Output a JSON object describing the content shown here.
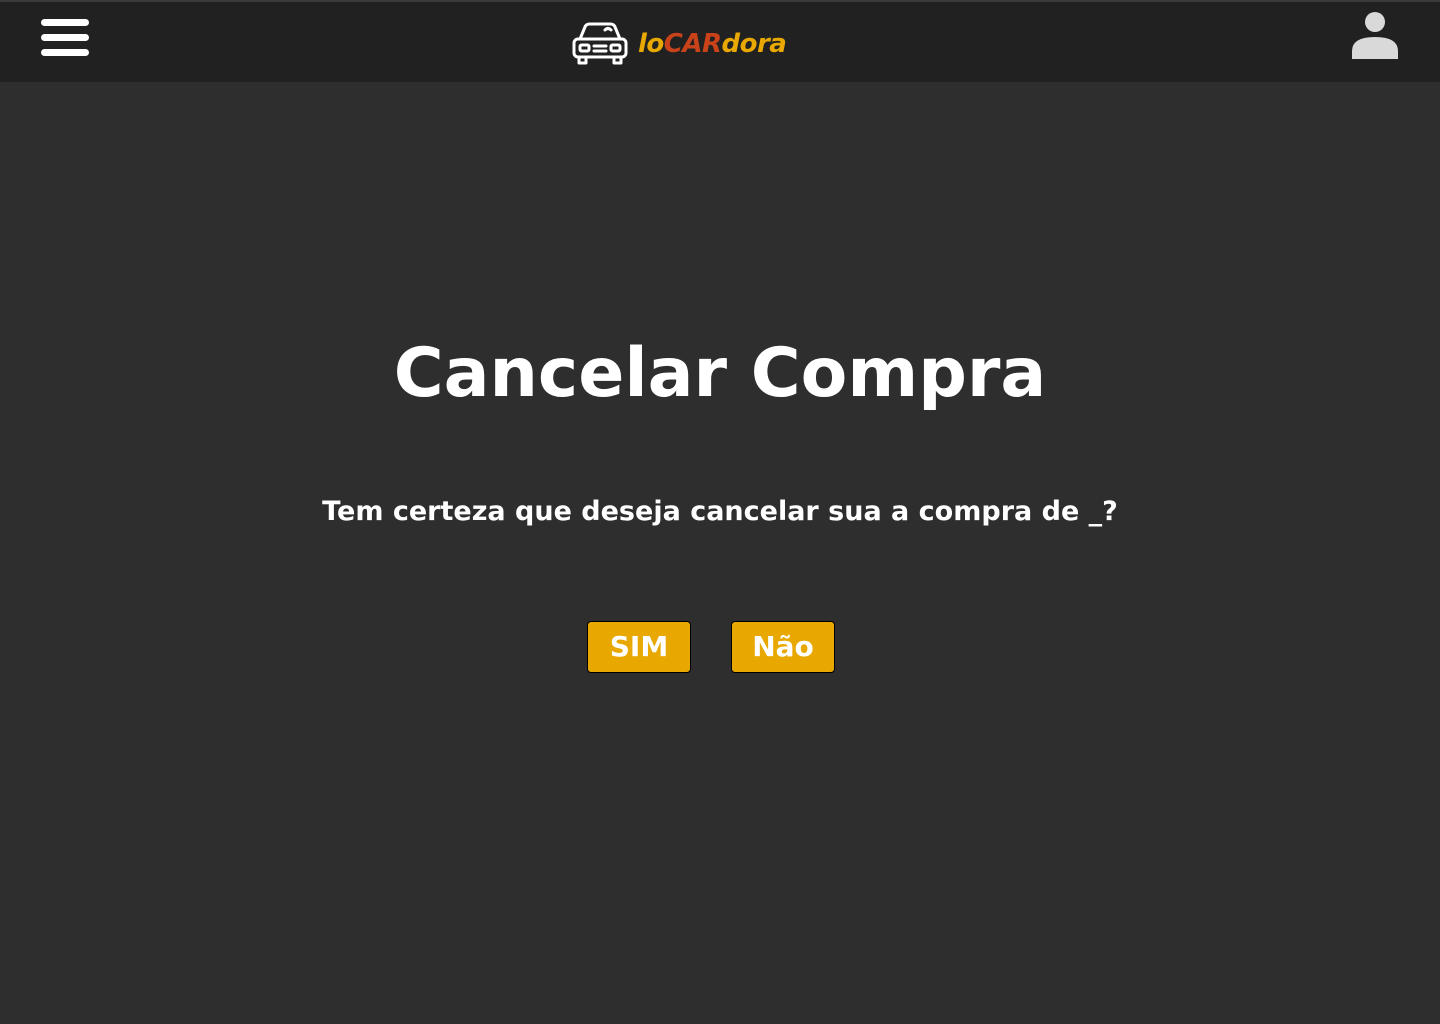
{
  "header": {
    "menu_icon": "hamburger-menu-icon",
    "logo_icon": "car-icon",
    "brand": {
      "part1": "lo",
      "part2": "CAR",
      "part3": "dora"
    },
    "user_icon": "user-avatar-icon"
  },
  "main": {
    "title": "Cancelar Compra",
    "question": "Tem certeza que deseja cancelar sua a compra de _?",
    "yes_label": "SIM",
    "no_label": "Não"
  },
  "colors": {
    "background": "#2e2e2e",
    "header": "#212121",
    "accent": "#e8a800",
    "brand_red": "#c9421a",
    "text": "#ffffff"
  }
}
